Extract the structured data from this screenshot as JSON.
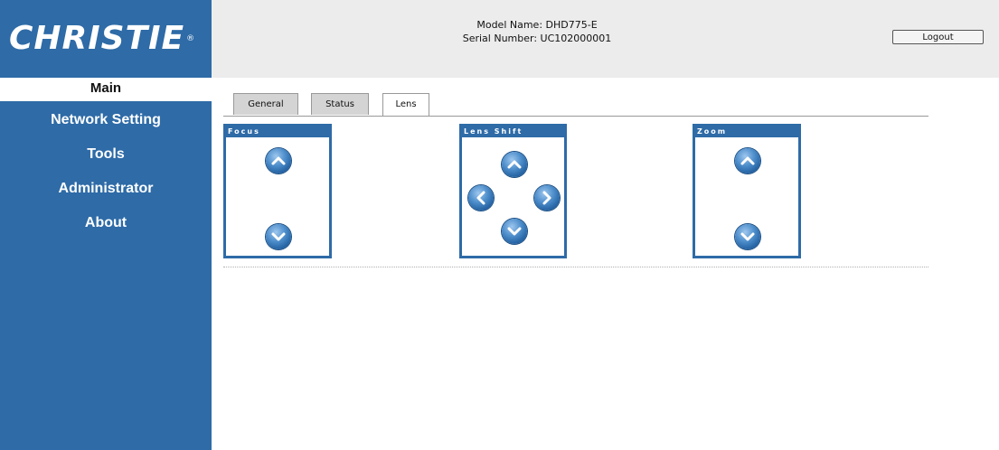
{
  "brand": {
    "logo_text": "CHRISTIE",
    "logo_mark": "®"
  },
  "header": {
    "model_name": "Model Name: DHD775-E",
    "serial_number": "Serial Number: UC102000001",
    "logout_label": "Logout"
  },
  "sidebar": {
    "items": [
      {
        "label": "Main"
      },
      {
        "label": "Network Setting"
      },
      {
        "label": "Tools"
      },
      {
        "label": "Administrator"
      },
      {
        "label": "About"
      }
    ]
  },
  "tabs": [
    {
      "label": "General",
      "active": false
    },
    {
      "label": "Status",
      "active": false
    },
    {
      "label": "Lens",
      "active": true
    }
  ],
  "panels": {
    "focus": {
      "title": "Focus",
      "buttons": [
        "arrow-up-icon",
        "arrow-down-icon"
      ]
    },
    "lens_shift": {
      "title": "Lens Shift",
      "buttons": [
        "arrow-up-icon",
        "arrow-left-icon",
        "arrow-right-icon",
        "arrow-down-icon"
      ]
    },
    "zoom": {
      "title": "Zoom",
      "buttons": [
        "arrow-up-icon",
        "arrow-down-icon"
      ]
    }
  },
  "colors": {
    "sidebar_bg": "#2e6ba7",
    "header_bg": "#ececec",
    "panel_border": "#2e6ba7",
    "button_blue": "#1f5d9e"
  }
}
